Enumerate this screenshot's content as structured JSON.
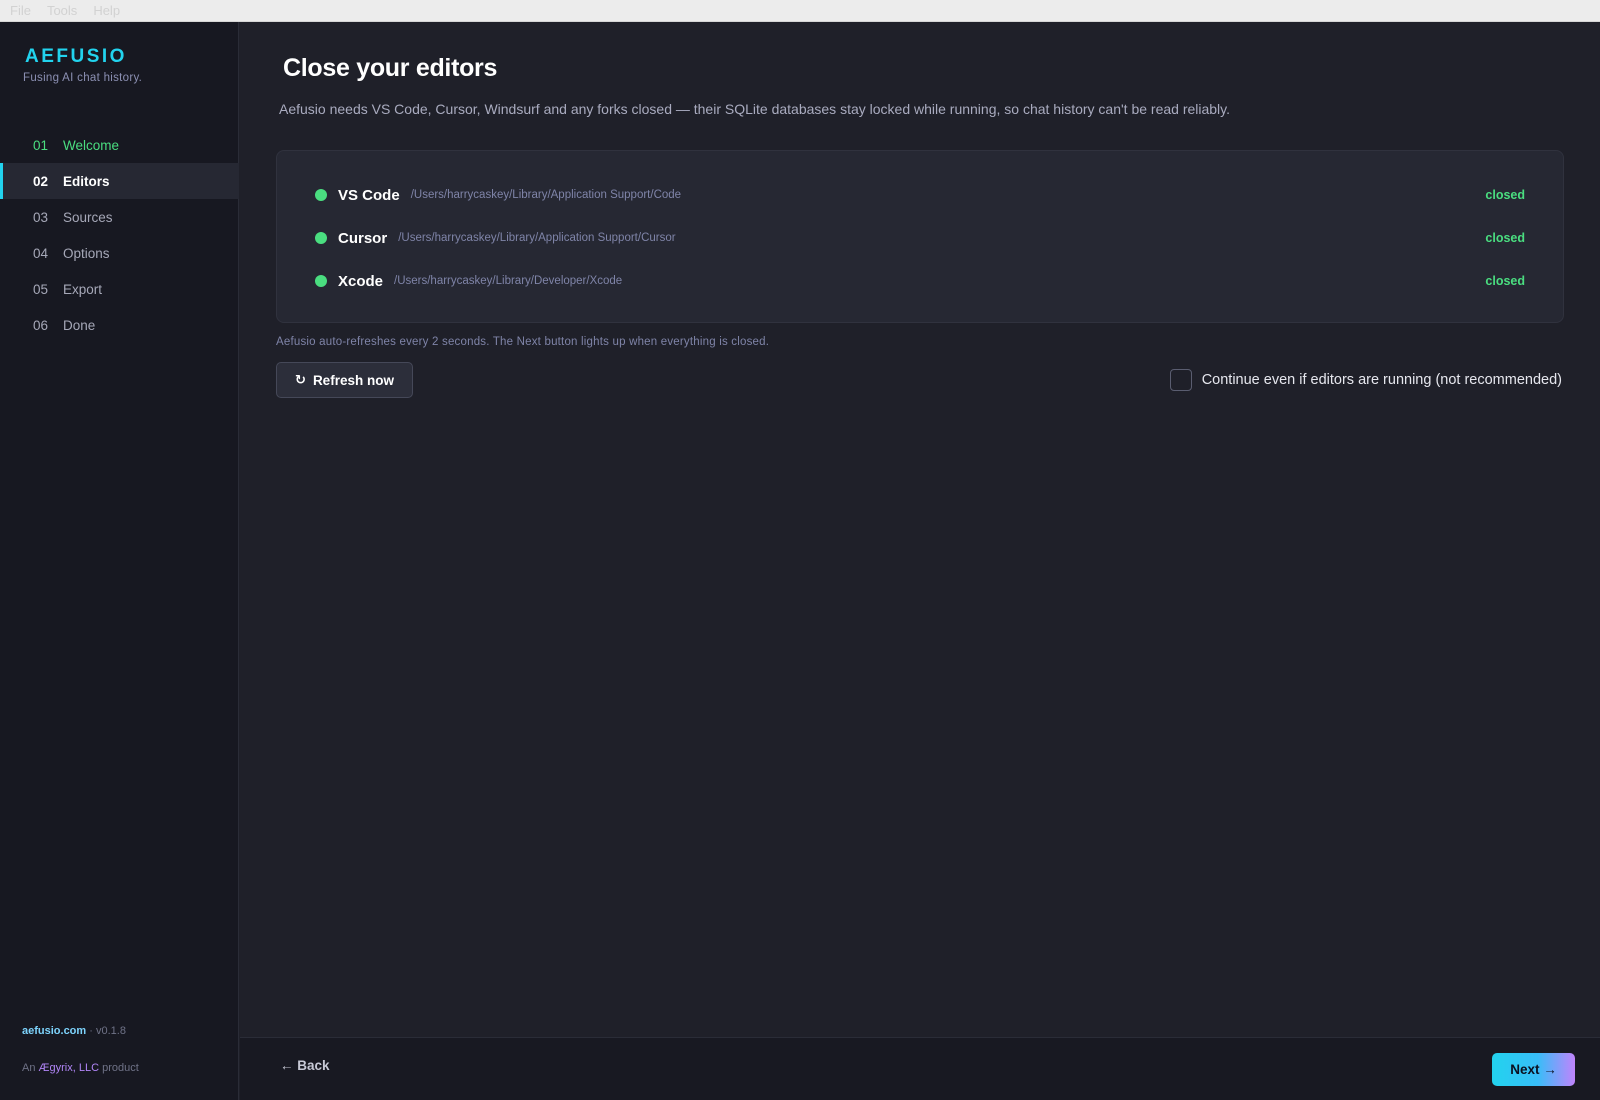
{
  "menubar": {
    "items": [
      "File",
      "Tools",
      "Help"
    ]
  },
  "sidebar": {
    "brand": "AEFUSIO",
    "tagline": "Fusing AI chat history.",
    "steps": [
      {
        "num": "01",
        "label": "Welcome",
        "state": "done"
      },
      {
        "num": "02",
        "label": "Editors",
        "state": "active"
      },
      {
        "num": "03",
        "label": "Sources",
        "state": "pending"
      },
      {
        "num": "04",
        "label": "Options",
        "state": "pending"
      },
      {
        "num": "05",
        "label": "Export",
        "state": "pending"
      },
      {
        "num": "06",
        "label": "Done",
        "state": "pending"
      }
    ],
    "footer": {
      "site": "aefusio.com",
      "separator": "·",
      "version": "v0.1.8",
      "product_prefix": "An",
      "company": "Ægyrix, LLC",
      "product_suffix": "product"
    }
  },
  "main": {
    "title": "Close your editors",
    "description": "Aefusio needs VS Code, Cursor, Windsurf and any forks closed — their SQLite databases stay locked while running, so chat history can't be read reliably.",
    "editors": [
      {
        "name": "VS Code",
        "path": "/Users/harrycaskey/Library/Application Support/Code",
        "status": "closed"
      },
      {
        "name": "Cursor",
        "path": "/Users/harrycaskey/Library/Application Support/Cursor",
        "status": "closed"
      },
      {
        "name": "Xcode",
        "path": "/Users/harrycaskey/Library/Developer/Xcode",
        "status": "closed"
      }
    ],
    "hint": "Aefusio auto-refreshes every 2 seconds. The Next button lights up when everything is closed.",
    "refresh_icon": "↻",
    "refresh_label": "Refresh now",
    "continue_label": "Continue even if editors are running (not recommended)",
    "continue_checked": false
  },
  "footer": {
    "back_label": "← Back",
    "next_label": "Next →"
  },
  "colors": {
    "accent": "#22d3ee",
    "success": "#4ade80",
    "company": "#b185f7"
  }
}
